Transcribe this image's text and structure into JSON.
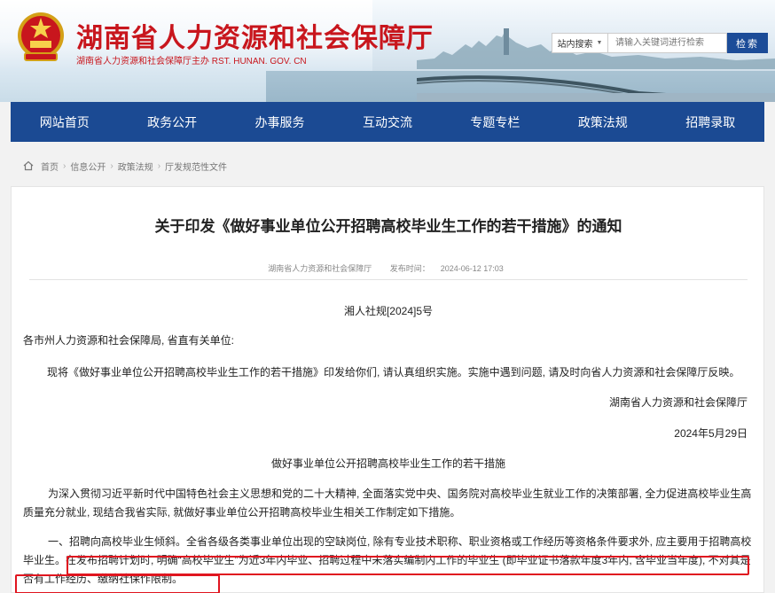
{
  "header": {
    "site_title": "湖南省人力资源和社会保障厅",
    "site_sub": "湖南省人力资源和社会保障厅主办  RST. HUNAN. GOV. CN",
    "search_scope": "站内搜索",
    "search_placeholder": "请输入关键词进行检索",
    "search_button": "检索"
  },
  "nav": {
    "items": [
      "网站首页",
      "政务公开",
      "办事服务",
      "互动交流",
      "专题专栏",
      "政策法规",
      "招聘录取"
    ]
  },
  "breadcrumb": {
    "items": [
      "首页",
      "信息公开",
      "政策法规",
      "厅发规范性文件"
    ]
  },
  "article": {
    "title": "关于印发《做好事业单位公开招聘高校毕业生工作的若干措施》的通知",
    "source": "湖南省人力资源和社会保障厅",
    "publish_label": "发布时间：",
    "publish_time": "2024-06-12 17:03",
    "doc_no": "湘人社规[2024]5号",
    "addressee": "各市州人力资源和社会保障局, 省直有关单位:",
    "intro": "现将《做好事业单位公开招聘高校毕业生工作的若干措施》印发给你们, 请认真组织实施。实施中遇到问题, 请及时向省人力资源和社会保障厅反映。",
    "signer": "湖南省人力资源和社会保障厅",
    "sign_date": "2024年5月29日",
    "sub_title": "做好事业单位公开招聘高校毕业生工作的若干措施",
    "para1": "为深入贯彻习近平新时代中国特色社会主义思想和党的二十大精神, 全面落实党中央、国务院对高校毕业生就业工作的决策部署, 全力促进高校毕业生高质量充分就业, 现结合我省实际, 就做好事业单位公开招聘高校毕业生相关工作制定如下措施。",
    "para2": "一、招聘向高校毕业生倾斜。全省各级各类事业单位出现的空缺岗位, 除有专业技术职称、职业资格或工作经历等资格条件要求外, 应主要用于招聘高校毕业生。在发布招聘计划时, 明确“高校毕业生”为近3年内毕业、招聘过程中未落实编制内工作的毕业生 (即毕业证书落款年度3年内, 含毕业当年度), 不对其是否有工作经历、缴纳社保作限制。"
  },
  "colors": {
    "brand_red": "#c8161d",
    "nav_blue": "#1b4a93",
    "highlight_red": "#e0151f"
  }
}
